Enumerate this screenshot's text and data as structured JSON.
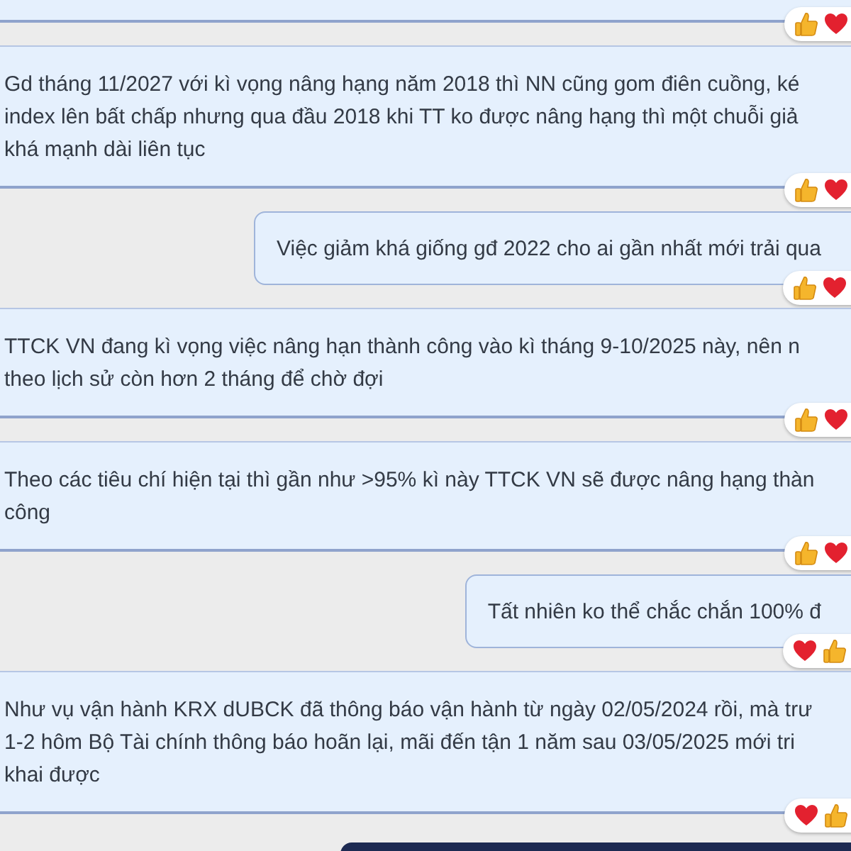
{
  "messages": [
    {
      "kind": "incoming",
      "partial": true,
      "reactions": [
        {
          "kind": "like"
        },
        {
          "kind": "heart"
        }
      ]
    },
    {
      "kind": "incoming",
      "partial": false,
      "lines": [
        "Gd tháng 11/2027 với kì vọng nâng hạng năm 2018 thì NN cũng gom điên cuồng, ké",
        "index lên bất chấp nhưng qua đầu 2018 khi TT ko được nâng hạng thì một chuỗi giả",
        "khá mạnh dài liên tục"
      ],
      "reactions": [
        {
          "kind": "like"
        },
        {
          "kind": "heart"
        }
      ]
    },
    {
      "kind": "outgoing",
      "partial": false,
      "lines": [
        "Việc giảm khá giống gđ 2022 cho ai gần nhất mới trải qua"
      ],
      "reactions": [
        {
          "kind": "like"
        },
        {
          "kind": "heart"
        }
      ]
    },
    {
      "kind": "incoming",
      "partial": false,
      "lines": [
        "TTCK VN đang kì vọng việc nâng hạn thành công vào kì tháng 9-10/2025 này, nên n",
        "theo lịch sử còn hơn 2 tháng để chờ đợi"
      ],
      "reactions": [
        {
          "kind": "like"
        },
        {
          "kind": "heart"
        }
      ]
    },
    {
      "kind": "incoming",
      "partial": false,
      "lines": [
        "Theo các tiêu chí hiện tại thì gần như >95% kì này TTCK VN sẽ được nâng hạng thàn",
        "công"
      ],
      "reactions": [
        {
          "kind": "like"
        },
        {
          "kind": "heart"
        }
      ]
    },
    {
      "kind": "outgoing",
      "partial": false,
      "lines": [
        "Tất nhiên ko thể chắc chắn 100% đ"
      ],
      "reactions": [
        {
          "kind": "heart"
        },
        {
          "kind": "like"
        }
      ]
    },
    {
      "kind": "incoming",
      "partial": false,
      "lines": [
        "Như vụ vận hành KRX dUBCK đã thông báo vận hành từ ngày 02/05/2024 rồi, mà trư",
        "1-2 hôm Bộ Tài chính thông báo hoãn lại,  mãi đến tận 1 năm sau 03/05/2025 mới tri",
        "khai được"
      ],
      "reactions": [
        {
          "kind": "heart"
        },
        {
          "kind": "like"
        }
      ]
    },
    {
      "kind": "outgoing",
      "partial": true
    }
  ]
}
